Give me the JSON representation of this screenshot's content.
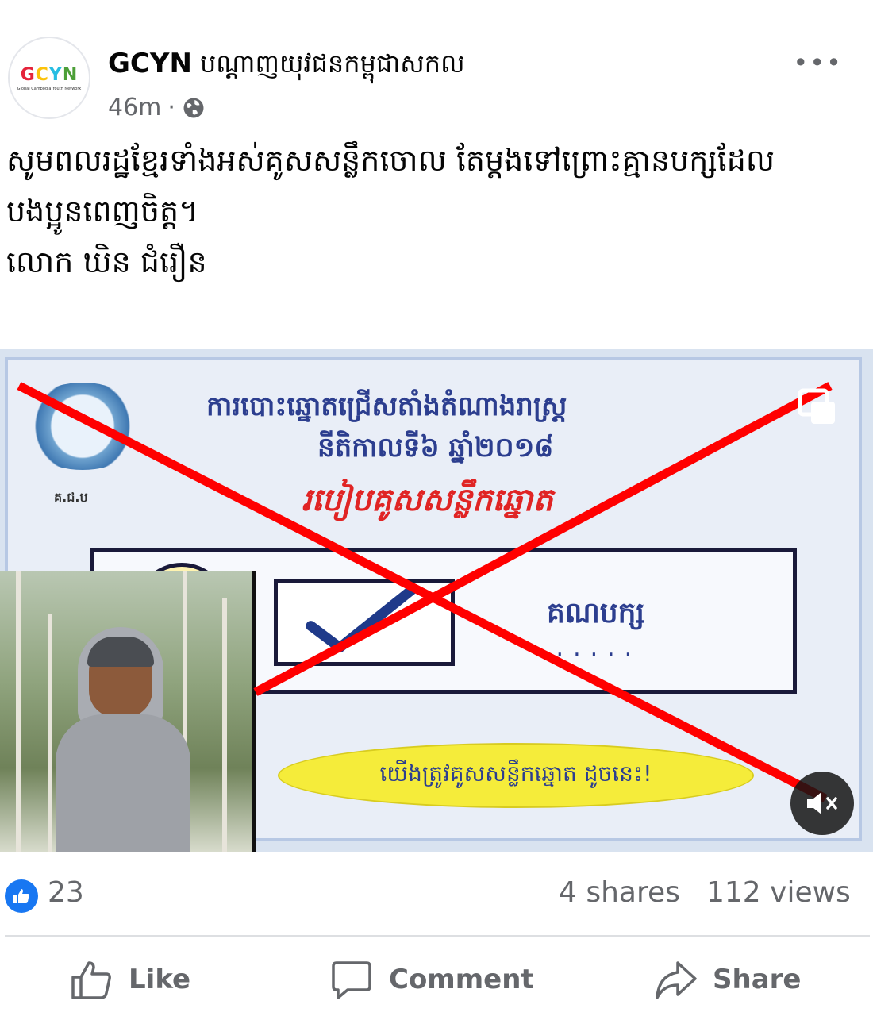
{
  "post": {
    "page_name": "GCYN",
    "page_name_kh": "បណ្ដាញយុវជនកម្ពុជាសកល",
    "avatar_logo_letters": [
      "G",
      "C",
      "Y",
      "N"
    ],
    "avatar_subtitle": "Global Cambodia Youth Network",
    "time": "46m",
    "separator": "·",
    "privacy_icon": "globe-icon",
    "more_icon": "more-icon"
  },
  "text": {
    "line1": "សូមពលរដ្ឋខ្មែរទាំងអស់គូសសន្លឹកចោល តែម្ដងទៅព្រោះគ្មានបក្សដែល",
    "line2": "បងប្អូនពេញចិត្ត។",
    "line3": "លោក ឃិន ជំរឿន"
  },
  "media": {
    "title1": "ការបោះឆ្នោតជ្រើសតាំងតំណាងរាស្ត្រ",
    "title2": "នីតិកាលទី៦ ឆ្នាំ២០១៨",
    "title3": "របៀបគូសសន្លឹកឆ្នោត",
    "nec_abbr": "គ.ជ.ប",
    "party_label": "គណបក្ស",
    "party_dots": "......",
    "speech": "យើងត្រូវគូសសន្លឹកឆ្នោត ដូចនេះ!",
    "overlay_color": "#ff0000",
    "mute_icon": "mute-icon"
  },
  "stats": {
    "likes": "23",
    "shares": "4 shares",
    "views": "112 views",
    "like_badge_color": "#1877f2"
  },
  "actions": {
    "like": "Like",
    "comment": "Comment",
    "share": "Share"
  }
}
